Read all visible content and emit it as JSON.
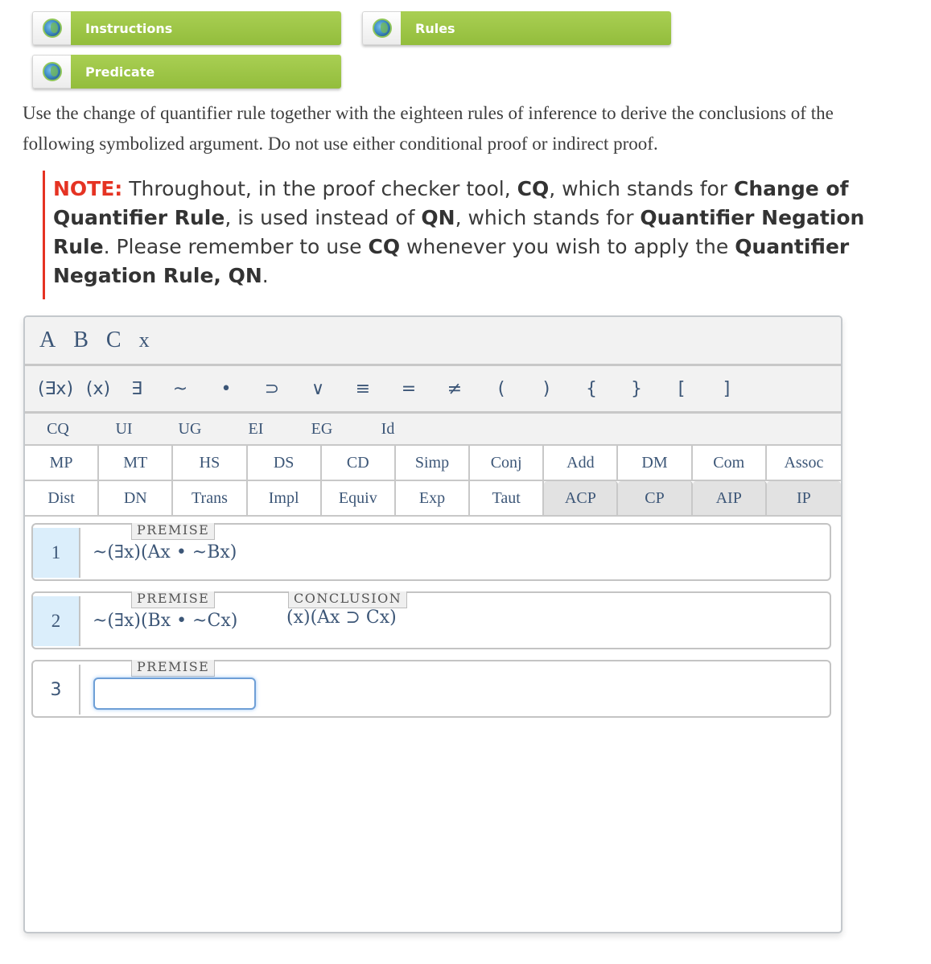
{
  "nav": {
    "buttons": [
      {
        "label": "Instructions",
        "icon": "globe-icon"
      },
      {
        "label": "Rules",
        "icon": "globe-icon"
      },
      {
        "label": "Predicate",
        "icon": "globe-icon"
      }
    ]
  },
  "instructions": {
    "line1": "Use the change of quantifier rule together with the eighteen rules of inference to derive the conclusions of the",
    "line2": "following symbolized argument. Do not use either conditional proof or indirect proof."
  },
  "note": {
    "label": "NOTE:",
    "t1": " Throughout, in the proof checker tool, ",
    "b1": "CQ",
    "t2": ", which stands for ",
    "b2": "Change of Quantifier Rule",
    "t3": ", is used instead of ",
    "b3": "QN",
    "t4": ", which stands for ",
    "b4": "Quantifier Negation Rule",
    "t5": ". Please remember to use ",
    "b5": "CQ",
    "t6": " whenever you wish to apply the ",
    "b6": "Quantifier Negation Rule, QN",
    "t7": "."
  },
  "tool": {
    "variables": [
      "A",
      "B",
      "C",
      "x"
    ],
    "symbols": [
      "(∃x)",
      "(x)",
      "∃",
      "~",
      "•",
      "⊃",
      "∨",
      "≡",
      "=",
      "≠",
      "(",
      ")",
      "{",
      "}",
      "[",
      "]"
    ],
    "quantifier_rules": [
      "CQ",
      "UI",
      "UG",
      "EI",
      "EG",
      "Id"
    ],
    "rules_row1": [
      "MP",
      "MT",
      "HS",
      "DS",
      "CD",
      "Simp",
      "Conj",
      "Add",
      "DM",
      "Com",
      "Assoc"
    ],
    "rules_row2": [
      "Dist",
      "DN",
      "Trans",
      "Impl",
      "Equiv",
      "Exp",
      "Taut",
      "ACP",
      "CP",
      "AIP",
      "IP"
    ],
    "lines": [
      {
        "number": "1",
        "tag": "PREMISE",
        "formula": "~(∃x)(Ax • ~Bx)"
      },
      {
        "number": "2",
        "tag": "PREMISE",
        "formula": "~(∃x)(Bx • ~Cx)",
        "conclusion_tag": "CONCLUSION",
        "conclusion": "(x)(Ax ⊃ Cx)"
      },
      {
        "number": "3",
        "tag": "PREMISE",
        "input_value": ""
      }
    ]
  }
}
